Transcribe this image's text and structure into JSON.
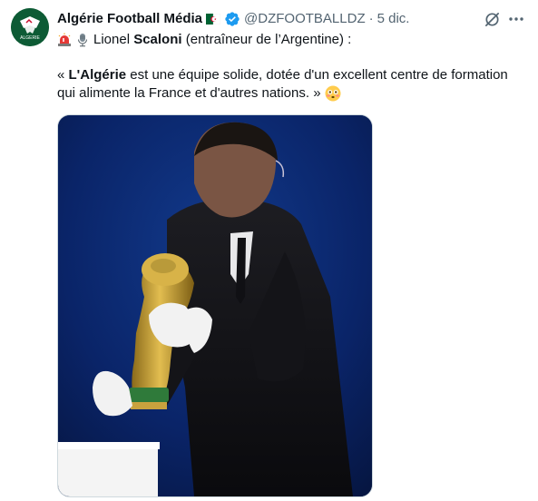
{
  "author": {
    "display_name": "Algérie Football Média",
    "handle": "@DZFOOTBALLDZ",
    "separator": "·",
    "timestamp": "5 dic.",
    "verified": true,
    "avatar_logo_text": "ALGERIE"
  },
  "icons": {
    "flag": "algeria-flag-icon",
    "verified": "verified-badge-icon",
    "grok": "grok-icon",
    "more": "more-icon",
    "siren": "siren-emoji-icon",
    "microphone": "microphone-emoji-icon",
    "flushed": "flushed-face-emoji-icon"
  },
  "tweet": {
    "line1_prefix": "Lionel ",
    "line1_bold": "Scaloni",
    "line1_suffix": " (entraîneur de l’Argentine) :",
    "line2_prefix": "« ",
    "line2_bold": "L'Algérie",
    "line2_suffix": " est une équipe solide, dotée d'un excellent centre de formation",
    "line3": "qui alimente la France et d'autres nations. »"
  },
  "colors": {
    "text": "#0f1419",
    "secondary": "#536471",
    "verified_blue": "#1d9bf0",
    "avatar_green": "#0d5b35"
  }
}
